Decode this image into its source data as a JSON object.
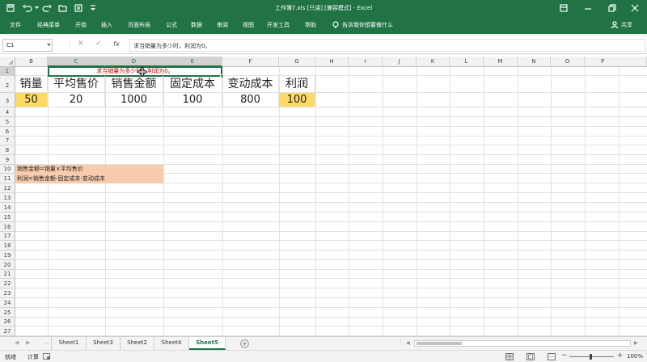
{
  "window": {
    "title": "工作簿7.xls [只读] [兼容模式] - Excel"
  },
  "ribbon": {
    "tabs": [
      "文件",
      "经典菜单",
      "开始",
      "插入",
      "页面布局",
      "公式",
      "数据",
      "审阅",
      "视图",
      "开发工具",
      "帮助"
    ],
    "search_placeholder": "告诉我你想要做什么",
    "share_label": "共享"
  },
  "formula_bar": {
    "name_box": "C1",
    "fx_symbol": "fx",
    "value": "求当销量为多少时，利润为0。"
  },
  "columns": [
    "B",
    "C",
    "D",
    "E",
    "F",
    "G",
    "H",
    "I",
    "J",
    "K",
    "L",
    "M",
    "N",
    "O",
    "P"
  ],
  "rows": [
    "1",
    "2",
    "3",
    "4",
    "5",
    "6",
    "7",
    "8",
    "9",
    "10",
    "11",
    "12",
    "13",
    "14",
    "15",
    "16",
    "17",
    "18",
    "19",
    "20",
    "21",
    "22",
    "23",
    "24",
    "25",
    "26",
    "27"
  ],
  "cells": {
    "c1_question": "求当销量为多少时，利润为0。",
    "headers": [
      "销量",
      "平均售价",
      "销售金额",
      "固定成本",
      "变动成本",
      "利润"
    ],
    "values": [
      "50",
      "20",
      "1000",
      "100",
      "800",
      "100"
    ],
    "note1": "销售金额=销量×平均售价",
    "note2": "利润=销售金额-固定成本-变动成本"
  },
  "sheets": {
    "tabs": [
      "Sheet1",
      "Sheet3",
      "Sheet2",
      "Sheet4",
      "Sheet5"
    ],
    "active": "Sheet5"
  },
  "status": {
    "ready": "就绪",
    "calc": "计算",
    "zoom": "100%"
  },
  "colors": {
    "excel_green": "#217346",
    "highlight_yellow": "#ffd966",
    "note_orange": "#f8cbad",
    "question_red": "#c00000"
  }
}
